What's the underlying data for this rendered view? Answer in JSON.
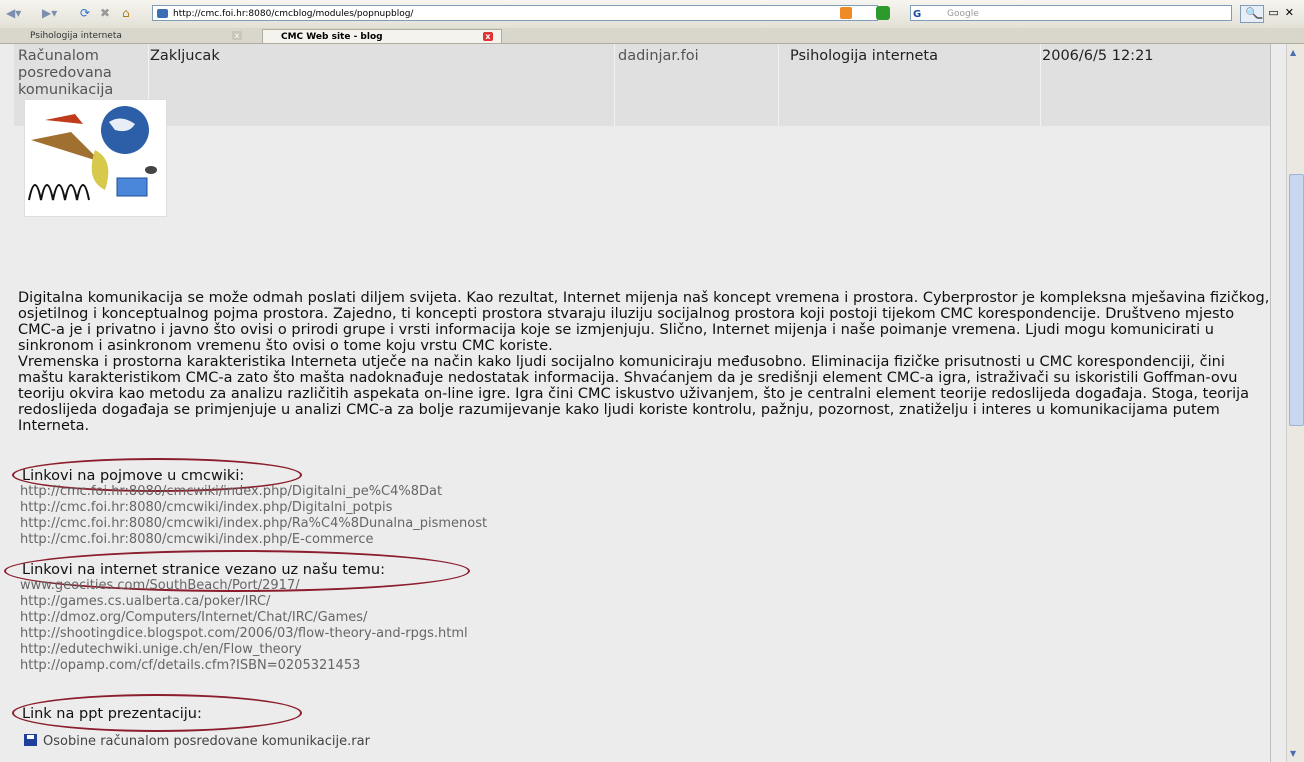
{
  "browser": {
    "url": "http://cmc.foi.hr:8080/cmcblog/modules/popnupblog/",
    "search_placeholder": "Google",
    "search_engine": "G",
    "tabs": [
      {
        "label": "Psihologija interneta"
      },
      {
        "label": "CMC Web site - blog"
      }
    ]
  },
  "table_row": {
    "category": "Računalom posredovana komunikacija",
    "title": "Zakljucak",
    "author": "dadinjar.foi",
    "blog": "Psihologija interneta",
    "date": "2006/6/5 12:21"
  },
  "post": {
    "paragraph1": "Digitalna komunikacija se može odmah poslati diljem svijeta. Kao rezultat, Internet mijenja naš koncept vremena i prostora. Cyberprostor je kompleksna mješavina fizičkog, osjetilnog i konceptualnog pojma prostora. Zajedno, ti koncepti prostora stvaraju iluziju socijalnog prostora koji postoji tijekom CMC korespondencije. Društveno mjesto CMC-a je i privatno i javno što ovisi o prirodi grupe i vrsti informacija koje se izmjenjuju. Slično, Internet mijenja i naše poimanje vremena. Ljudi mogu komunicirati u sinkronom i asinkronom vremenu što ovisi o tome koju vrstu CMC koriste.",
    "paragraph2": "Vremenska i prostorna karakteristika Interneta utječe na način kako ljudi socijalno komuniciraju međusobno. Eliminacija fizičke prisutnosti u CMC korespondenciji, čini maštu karakteristikom CMC-a zato što mašta nadoknađuje nedostatak informacija. Shvaćanjem da je središnji element CMC-a igra, istraživači su iskoristili Goffman-ovu teoriju okvira kao metodu za analizu različitih aspekata on-line igre. Igra čini CMC iskustvo uživanjem, što je centralni element teorije redoslijeda događaja. Stoga, teorija redoslijeda događaja se primjenjuje u analizi CMC-a za bolje razumijevanje kako ljudi koriste kontrolu, pažnju, pozornost, znatiželju i interes u komunikacijama putem Interneta."
  },
  "wiki_section": {
    "heading": "Linkovi na pojmove u cmcwiki:",
    "links": [
      "http://cmc.foi.hr:8080/cmcwiki/index.php/Digitalni_pe%C4%8Dat",
      "http://cmc.foi.hr:8080/cmcwiki/index.php/Digitalni_potpis",
      "http://cmc.foi.hr:8080/cmcwiki/index.php/Ra%C4%8Dunalna_pismenost",
      "http://cmc.foi.hr:8080/cmcwiki/index.php/E-commerce"
    ]
  },
  "web_section": {
    "heading": "Linkovi na internet stranice vezano uz našu temu:",
    "links": [
      "www.geocities.com/SouthBeach/Port/2917/",
      "http://games.cs.ualberta.ca/poker/IRC/",
      "http://dmoz.org/Computers/Internet/Chat/IRC/Games/",
      "http://shootingdice.blogspot.com/2006/03/flow-theory-and-rpgs.html",
      "http://edutechwiki.unige.ch/en/Flow_theory",
      "http://opamp.com/cf/details.cfm?ISBN=0205321453"
    ]
  },
  "ppt_section": {
    "heading": "Link na ppt prezentaciju:",
    "attachment": "Osobine računalom posredovane komunikacije.rar"
  },
  "colors": {
    "annotation_oval": "#8b1d2c",
    "page_bg": "#ececec"
  }
}
